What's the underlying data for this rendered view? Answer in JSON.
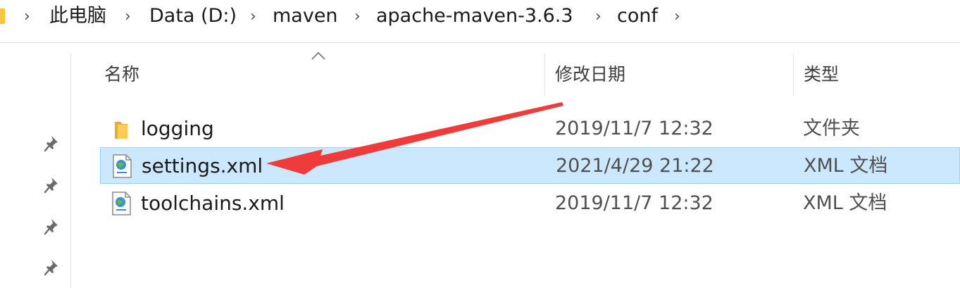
{
  "breadcrumb": {
    "items": [
      "此电脑",
      "Data (D:)",
      "maven",
      "apache-maven-3.6.3",
      "conf"
    ],
    "separator": "›"
  },
  "columns": {
    "name": "名称",
    "modified": "修改日期",
    "type": "类型"
  },
  "files": [
    {
      "name": "logging",
      "modified": "2019/11/7 12:32",
      "type": "文件夹",
      "icon": "folder-icon",
      "selected": false
    },
    {
      "name": "settings.xml",
      "modified": "2021/4/29 21:22",
      "type": "XML 文档",
      "icon": "xml-document-icon",
      "selected": true
    },
    {
      "name": "toolchains.xml",
      "modified": "2019/11/7 12:32",
      "type": "XML 文档",
      "icon": "xml-document-icon",
      "selected": false
    }
  ],
  "colors": {
    "selection_fill": "#cce8ff",
    "selection_border": "#99d1ff",
    "annotation_arrow": "#f03b3b",
    "folder": "#f6c343"
  },
  "annotation": {
    "type": "arrow",
    "target": "settings.xml"
  }
}
